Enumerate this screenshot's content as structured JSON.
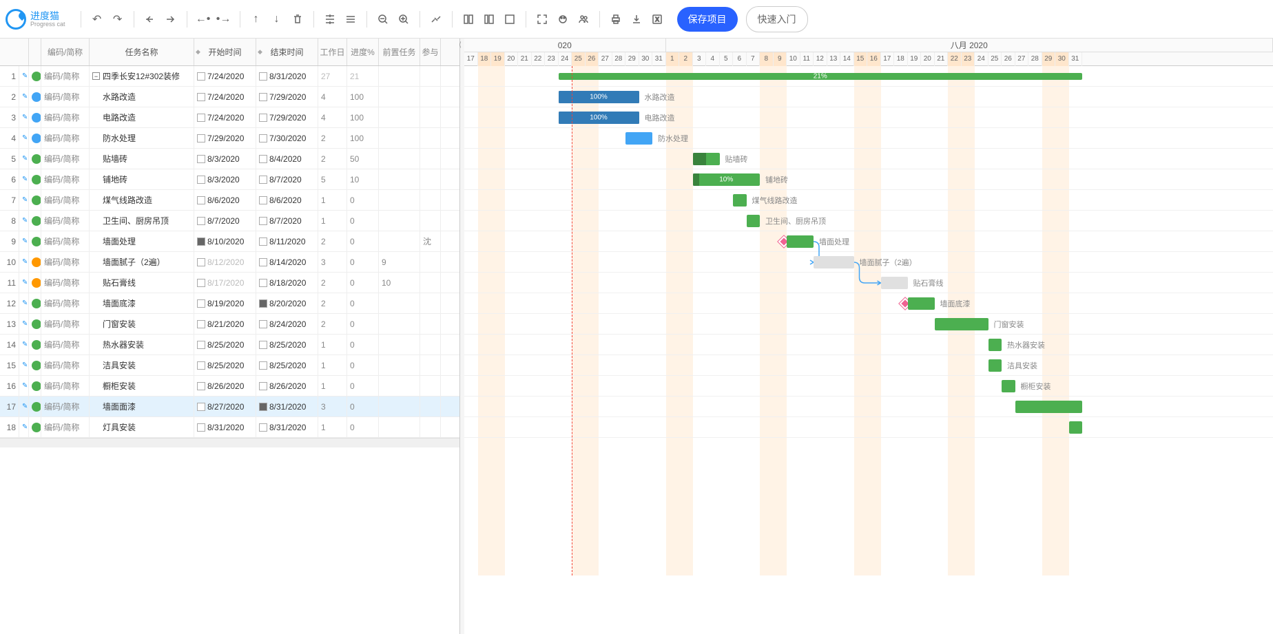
{
  "app": {
    "name": "进度猫",
    "sub": "Progress cat"
  },
  "toolbar": {
    "save": "保存项目",
    "quick": "快速入门"
  },
  "columns": {
    "code": "编码/简称",
    "task": "任务名称",
    "start": "开始时间",
    "end": "结束时间",
    "work": "工作日",
    "prog": "进度%",
    "pred": "前置任务",
    "assn": "参与"
  },
  "timeline": {
    "month1_label": "020",
    "month2_label": "八月 2020",
    "days": [
      {
        "d": 17,
        "w": false
      },
      {
        "d": 18,
        "w": true
      },
      {
        "d": 19,
        "w": true
      },
      {
        "d": 20,
        "w": false
      },
      {
        "d": 21,
        "w": false
      },
      {
        "d": 22,
        "w": false
      },
      {
        "d": 23,
        "w": false
      },
      {
        "d": 24,
        "w": false
      },
      {
        "d": 25,
        "w": true
      },
      {
        "d": 26,
        "w": true
      },
      {
        "d": 27,
        "w": false
      },
      {
        "d": 28,
        "w": false
      },
      {
        "d": 29,
        "w": false
      },
      {
        "d": 30,
        "w": false
      },
      {
        "d": 31,
        "w": false
      },
      {
        "d": 1,
        "w": true
      },
      {
        "d": 2,
        "w": true
      },
      {
        "d": 3,
        "w": false
      },
      {
        "d": 4,
        "w": false
      },
      {
        "d": 5,
        "w": false
      },
      {
        "d": 6,
        "w": false
      },
      {
        "d": 7,
        "w": false
      },
      {
        "d": 8,
        "w": true
      },
      {
        "d": 9,
        "w": true
      },
      {
        "d": 10,
        "w": false
      },
      {
        "d": 11,
        "w": false
      },
      {
        "d": 12,
        "w": false
      },
      {
        "d": 13,
        "w": false
      },
      {
        "d": 14,
        "w": false
      },
      {
        "d": 15,
        "w": true
      },
      {
        "d": 16,
        "w": true
      },
      {
        "d": 17,
        "w": false
      },
      {
        "d": 18,
        "w": false
      },
      {
        "d": 19,
        "w": false
      },
      {
        "d": 20,
        "w": false
      },
      {
        "d": 21,
        "w": false
      },
      {
        "d": 22,
        "w": true
      },
      {
        "d": 23,
        "w": true
      },
      {
        "d": 24,
        "w": false
      },
      {
        "d": 25,
        "w": false
      },
      {
        "d": 26,
        "w": false
      },
      {
        "d": 27,
        "w": false
      },
      {
        "d": 28,
        "w": false
      },
      {
        "d": 29,
        "w": true
      },
      {
        "d": 30,
        "w": true
      },
      {
        "d": 31,
        "w": false
      }
    ],
    "today_index": 8
  },
  "rows": [
    {
      "idx": 1,
      "color": "#4caf50",
      "code": "编码/简称",
      "task": "四季长安12#302装修",
      "start": "7/24/2020",
      "startChk": false,
      "end": "8/31/2020",
      "endChk": false,
      "work": "27",
      "workDim": true,
      "prog": "21",
      "progDim": true,
      "pred": "",
      "assn": "",
      "summary": true,
      "barStart": 7,
      "barLen": 39,
      "barColor": "green",
      "barProg": 21,
      "barLabel": "21%",
      "barText": ""
    },
    {
      "idx": 2,
      "color": "#42a5f5",
      "code": "编码/简称",
      "task": "水路改造",
      "start": "7/24/2020",
      "startChk": false,
      "end": "7/29/2020",
      "endChk": false,
      "work": "4",
      "prog": "100",
      "pred": "",
      "assn": "",
      "barStart": 7,
      "barLen": 6,
      "barColor": "blue",
      "barProg": 100,
      "barLabel": "100%",
      "barText": "水路改造"
    },
    {
      "idx": 3,
      "color": "#42a5f5",
      "code": "编码/简称",
      "task": "电路改造",
      "start": "7/24/2020",
      "startChk": false,
      "end": "7/29/2020",
      "endChk": false,
      "work": "4",
      "prog": "100",
      "pred": "",
      "assn": "",
      "barStart": 7,
      "barLen": 6,
      "barColor": "blue",
      "barProg": 100,
      "barLabel": "100%",
      "barText": "电路改造"
    },
    {
      "idx": 4,
      "color": "#42a5f5",
      "code": "编码/简称",
      "task": "防水处理",
      "start": "7/29/2020",
      "startChk": false,
      "end": "7/30/2020",
      "endChk": false,
      "work": "2",
      "prog": "100",
      "pred": "",
      "assn": "",
      "barStart": 12,
      "barLen": 2,
      "barColor": "blue",
      "barText": "防水处理"
    },
    {
      "idx": 5,
      "color": "#4caf50",
      "code": "编码/简称",
      "task": "贴墙砖",
      "start": "8/3/2020",
      "startChk": false,
      "end": "8/4/2020",
      "endChk": false,
      "work": "2",
      "prog": "50",
      "pred": "",
      "assn": "",
      "barStart": 17,
      "barLen": 2,
      "barColor": "green",
      "barProg": 50,
      "barText": "贴墙砖"
    },
    {
      "idx": 6,
      "color": "#4caf50",
      "code": "编码/简称",
      "task": "铺地砖",
      "start": "8/3/2020",
      "startChk": false,
      "end": "8/7/2020",
      "endChk": false,
      "work": "5",
      "prog": "10",
      "pred": "",
      "assn": "",
      "barStart": 17,
      "barLen": 5,
      "barColor": "green",
      "barProg": 10,
      "barLabel": "10%",
      "barText": "铺地砖"
    },
    {
      "idx": 7,
      "color": "#4caf50",
      "code": "编码/简称",
      "task": "煤气线路改造",
      "start": "8/6/2020",
      "startChk": false,
      "end": "8/6/2020",
      "endChk": false,
      "work": "1",
      "prog": "0",
      "pred": "",
      "assn": "",
      "barStart": 20,
      "barLen": 1,
      "barColor": "green",
      "barText": "煤气线路改造"
    },
    {
      "idx": 8,
      "color": "#4caf50",
      "code": "编码/简称",
      "task": "卫生间、厨房吊顶",
      "start": "8/7/2020",
      "startChk": false,
      "end": "8/7/2020",
      "endChk": false,
      "work": "1",
      "prog": "0",
      "pred": "",
      "assn": "",
      "barStart": 21,
      "barLen": 1,
      "barColor": "green",
      "barText": "卫生间、厨房吊顶"
    },
    {
      "idx": 9,
      "color": "#4caf50",
      "code": "编码/简称",
      "task": "墙面处理",
      "start": "8/10/2020",
      "startChk": true,
      "end": "8/11/2020",
      "endChk": false,
      "work": "2",
      "prog": "0",
      "pred": "",
      "assn": "沈",
      "barStart": 24,
      "barLen": 2,
      "barColor": "green",
      "barText": "墙面处理",
      "milestone": true
    },
    {
      "idx": 10,
      "color": "#ff9800",
      "code": "编码/简称",
      "task": "墙面腻子（2遍）",
      "start": "8/12/2020",
      "startDim": true,
      "startChk": false,
      "end": "8/14/2020",
      "endChk": false,
      "work": "3",
      "prog": "0",
      "pred": "9",
      "assn": "",
      "barStart": 26,
      "barLen": 3,
      "barColor": "grey",
      "barText": "墙面腻子（2遍）",
      "linkFrom": 9
    },
    {
      "idx": 11,
      "color": "#ff9800",
      "code": "编码/简称",
      "task": "贴石膏线",
      "start": "8/17/2020",
      "startDim": true,
      "startChk": false,
      "end": "8/18/2020",
      "endChk": false,
      "work": "2",
      "prog": "0",
      "pred": "10",
      "assn": "",
      "barStart": 31,
      "barLen": 2,
      "barColor": "grey",
      "barText": "贴石膏线",
      "linkFrom": 10
    },
    {
      "idx": 12,
      "color": "#4caf50",
      "code": "编码/简称",
      "task": "墙面底漆",
      "start": "8/19/2020",
      "startChk": false,
      "end": "8/20/2020",
      "endChk": true,
      "work": "2",
      "prog": "0",
      "pred": "",
      "assn": "",
      "barStart": 33,
      "barLen": 2,
      "barColor": "green",
      "barText": "墙面底漆",
      "milestone": true
    },
    {
      "idx": 13,
      "color": "#4caf50",
      "code": "编码/简称",
      "task": "门窗安装",
      "start": "8/21/2020",
      "startChk": false,
      "end": "8/24/2020",
      "endChk": false,
      "work": "2",
      "prog": "0",
      "pred": "",
      "assn": "",
      "barStart": 35,
      "barLen": 4,
      "barColor": "green",
      "barText": "门窗安装"
    },
    {
      "idx": 14,
      "color": "#4caf50",
      "code": "编码/简称",
      "task": "热水器安装",
      "start": "8/25/2020",
      "startChk": false,
      "end": "8/25/2020",
      "endChk": false,
      "work": "1",
      "prog": "0",
      "pred": "",
      "assn": "",
      "barStart": 39,
      "barLen": 1,
      "barColor": "green",
      "barText": "热水器安装"
    },
    {
      "idx": 15,
      "color": "#4caf50",
      "code": "编码/简称",
      "task": "洁具安装",
      "start": "8/25/2020",
      "startChk": false,
      "end": "8/25/2020",
      "endChk": false,
      "work": "1",
      "prog": "0",
      "pred": "",
      "assn": "",
      "barStart": 39,
      "barLen": 1,
      "barColor": "green",
      "barText": "洁具安装"
    },
    {
      "idx": 16,
      "color": "#4caf50",
      "code": "编码/简称",
      "task": "橱柜安装",
      "start": "8/26/2020",
      "startChk": false,
      "end": "8/26/2020",
      "endChk": false,
      "work": "1",
      "prog": "0",
      "pred": "",
      "assn": "",
      "barStart": 40,
      "barLen": 1,
      "barColor": "green",
      "barText": "橱柜安装"
    },
    {
      "idx": 17,
      "color": "#4caf50",
      "code": "编码/简称",
      "task": "墙面面漆",
      "start": "8/27/2020",
      "startChk": false,
      "end": "8/31/2020",
      "endChk": true,
      "work": "3",
      "prog": "0",
      "pred": "",
      "assn": "",
      "barStart": 41,
      "barLen": 5,
      "barColor": "green",
      "barText": "",
      "selected": true
    },
    {
      "idx": 18,
      "color": "#4caf50",
      "code": "编码/简称",
      "task": "灯具安装",
      "start": "8/31/2020",
      "startChk": false,
      "end": "8/31/2020",
      "endChk": false,
      "work": "1",
      "prog": "0",
      "pred": "",
      "assn": "",
      "barStart": 45,
      "barLen": 1,
      "barColor": "green",
      "barText": ""
    }
  ]
}
